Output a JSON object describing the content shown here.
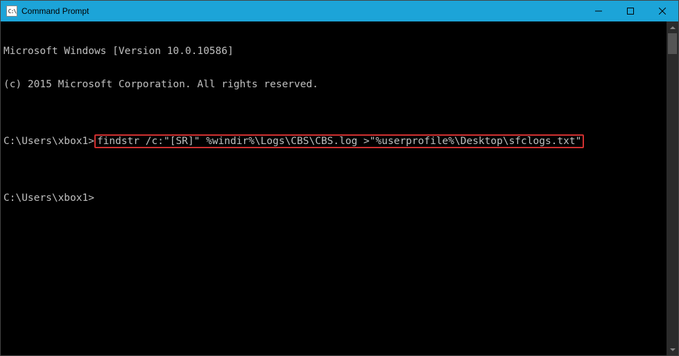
{
  "titlebar": {
    "icon_label": "C:\\",
    "title": "Command Prompt"
  },
  "controls": {
    "minimize": "Minimize",
    "maximize": "Maximize",
    "close": "Close"
  },
  "terminal": {
    "line1": "Microsoft Windows [Version 10.0.10586]",
    "line2": "(c) 2015 Microsoft Corporation. All rights reserved.",
    "blank": "",
    "prompt1_prefix": "C:\\Users\\xbox1>",
    "prompt1_cmd": "findstr /c:\"[SR]\" %windir%\\Logs\\CBS\\CBS.log >\"%userprofile%\\Desktop\\sfclogs.txt\"",
    "prompt2": "C:\\Users\\xbox1>"
  }
}
